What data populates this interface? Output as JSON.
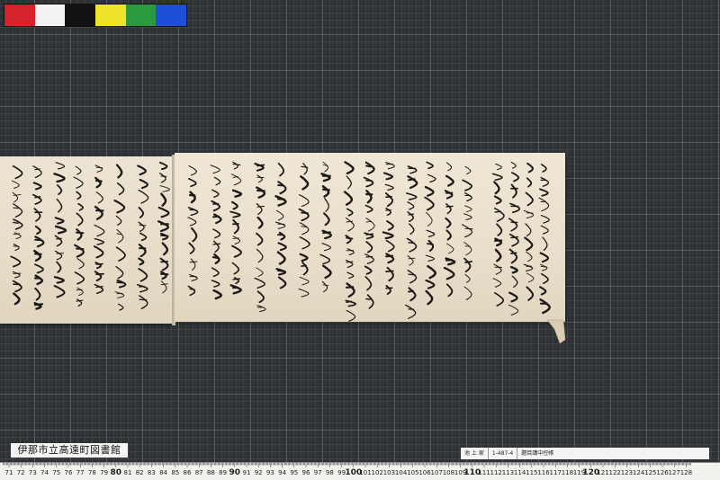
{
  "calibration_colors": [
    "#d5232d",
    "#f3f3f3",
    "#111111",
    "#efe22a",
    "#2a9a3e",
    "#1f4fd8"
  ],
  "library_label": "伊那市立高遠町図書館",
  "call_label": {
    "collection": "池 上 家",
    "number": "1-487-4",
    "title": "題目講中控帳"
  },
  "ruler": {
    "numbers": [
      "71",
      "72",
      "73",
      "74",
      "75",
      "76",
      "77",
      "78",
      "79",
      "80",
      "81",
      "82",
      "83",
      "84",
      "85",
      "86",
      "87",
      "88",
      "89",
      "90",
      "91",
      "92",
      "93",
      "94",
      "95",
      "96",
      "97",
      "98",
      "99",
      "100",
      "101",
      "102",
      "103",
      "104",
      "105",
      "106",
      "107",
      "108",
      "109",
      "110",
      "111",
      "112",
      "113",
      "114",
      "115",
      "116",
      "117",
      "118",
      "119",
      "120",
      "121",
      "122",
      "123",
      "124",
      "125",
      "126",
      "127",
      "128"
    ],
    "major": [
      "80",
      "90",
      "100",
      "110",
      "120"
    ]
  }
}
